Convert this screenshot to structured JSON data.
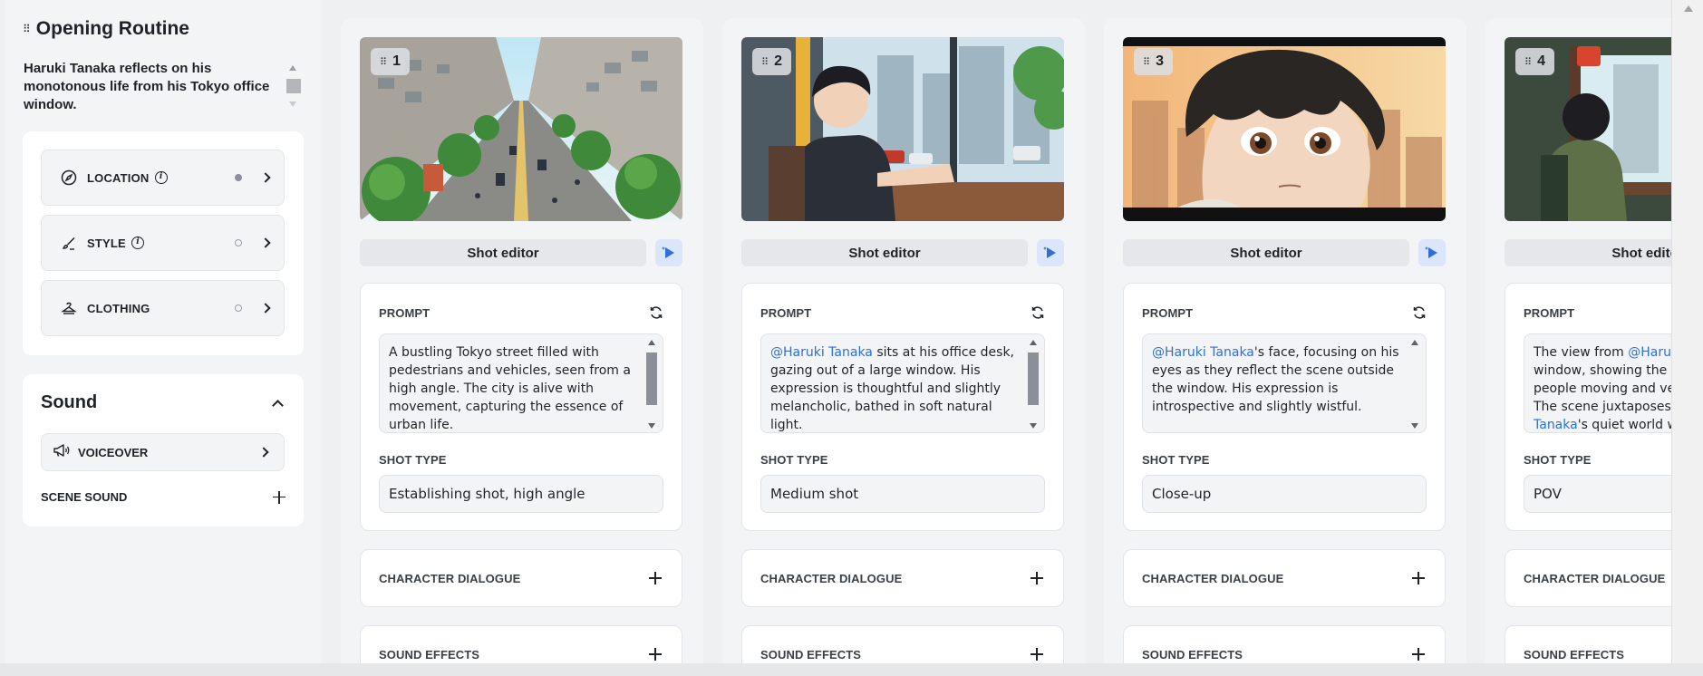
{
  "scene": {
    "title": "Opening Routine",
    "description": "Haruki Tanaka reflects on his monotonous life from his Tokyo office window."
  },
  "attributes": [
    {
      "label": "LOCATION",
      "icon": "compass-icon",
      "has_info": true,
      "status": "filled"
    },
    {
      "label": "STYLE",
      "icon": "brush-icon",
      "has_info": true,
      "status": "empty"
    },
    {
      "label": "CLOTHING",
      "icon": "hanger-icon",
      "has_info": false,
      "status": "empty"
    }
  ],
  "sound": {
    "title": "Sound",
    "voiceover_label": "VOICEOVER",
    "scene_sound_label": "SCENE SOUND"
  },
  "labels": {
    "shot_editor": "Shot editor",
    "prompt": "PROMPT",
    "shot_type": "SHOT TYPE",
    "character_dialogue": "CHARACTER DIALOGUE",
    "sound_effects": "SOUND EFFECTS"
  },
  "mention_name": "@Haruki Tanaka",
  "shots": [
    {
      "number": "1",
      "prompt_parts": [
        {
          "text": "A bustling Tokyo street filled with pedestrians and vehicles, seen from a high angle. The city is alive with movement, capturing the essence of urban life."
        }
      ],
      "shot_type": "Establishing shot, high angle"
    },
    {
      "number": "2",
      "prompt_parts": [
        {
          "text": "@Haruki Tanaka",
          "mention": true
        },
        {
          "text": " sits at his office desk, gazing out of a large window. His expression is thoughtful and slightly melancholic, bathed in soft natural light."
        }
      ],
      "shot_type": "Medium shot"
    },
    {
      "number": "3",
      "prompt_parts": [
        {
          "text": "@Haruki Tanaka",
          "mention": true
        },
        {
          "text": "'s face, focusing on his eyes as they reflect the scene outside the window. His expression is introspective and slightly wistful."
        }
      ],
      "shot_type": "Close-up"
    },
    {
      "number": "4",
      "prompt_parts": [
        {
          "text": "The view from "
        },
        {
          "text": "@Haruki Tanaka",
          "mention": true
        },
        {
          "text": "'s window, showing the street below with people moving and vehicles honking. The scene juxtaposes "
        },
        {
          "text": "@Haruki Tanaka",
          "mention": true
        },
        {
          "text": "'s quiet world with the busy city."
        }
      ],
      "shot_type": "POV"
    }
  ],
  "colors": {
    "accent": "#2f6fd6",
    "play_bg": "#dbe6fb",
    "panel_bg": "#f3f4f6"
  }
}
